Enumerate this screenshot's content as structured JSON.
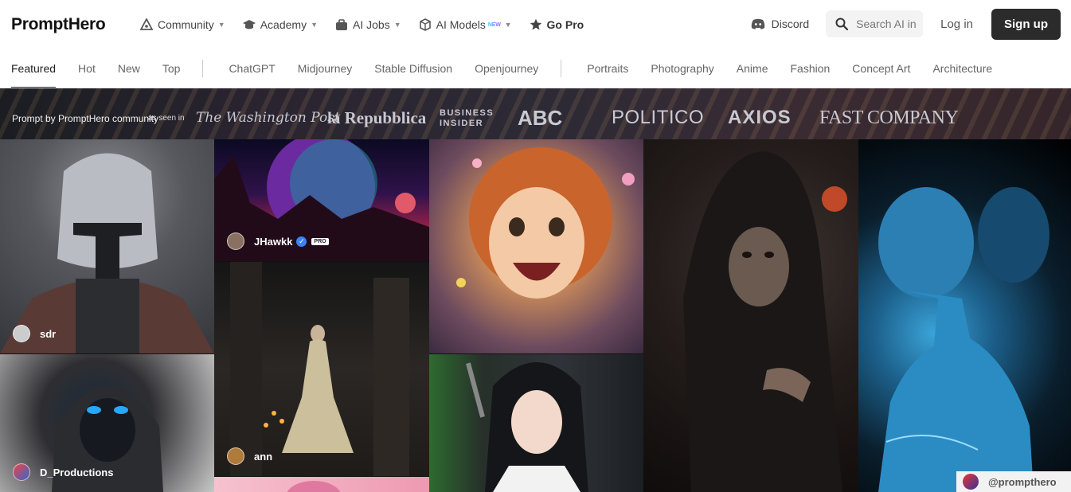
{
  "header": {
    "logo": "PromptHero",
    "nav": [
      {
        "label": "Community",
        "icon": "community-icon",
        "caret": true
      },
      {
        "label": "Academy",
        "icon": "graduation-cap-icon",
        "caret": true
      },
      {
        "label": "AI Jobs",
        "icon": "briefcase-icon",
        "caret": true
      },
      {
        "label": "AI Models",
        "icon": "cube-icon",
        "caret": true,
        "badge": "NEW"
      },
      {
        "label": "Go Pro",
        "icon": "star-icon",
        "caret": false
      }
    ],
    "discord_label": "Discord",
    "search_placeholder": "Search AI in",
    "login_label": "Log in",
    "signup_label": "Sign up"
  },
  "tabs": {
    "group1": [
      "Featured",
      "Hot",
      "New",
      "Top"
    ],
    "group2": [
      "ChatGPT",
      "Midjourney",
      "Stable Diffusion",
      "Openjourney"
    ],
    "group3": [
      "Portraits",
      "Photography",
      "Anime",
      "Fashion",
      "Concept Art",
      "Architecture"
    ],
    "active": "Featured"
  },
  "press": {
    "caption": "Prompt by PromptHero community",
    "as_seen": "as seen in",
    "publications": [
      "The Washington Post",
      "la Repubblica",
      "BUSINESS INSIDER",
      "ABC",
      "POLITICO",
      "AXIOS",
      "FAST COMPANY"
    ]
  },
  "gallery": {
    "cards": [
      {
        "user": "sdr"
      },
      {
        "user": "D_Productions"
      },
      {
        "user": "JHawkk",
        "verified": true,
        "pro": "PRO"
      },
      {
        "user": "ann"
      }
    ],
    "watermark": "@prompthero"
  },
  "colors": {
    "signup_bg": "#2b2b2b",
    "verified": "#3b82f6",
    "page_bg": "#ffffff"
  }
}
